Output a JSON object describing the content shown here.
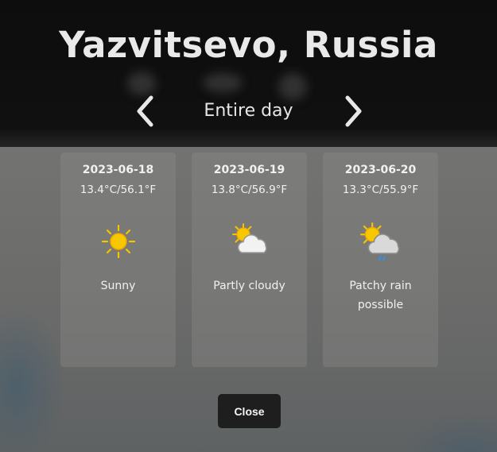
{
  "location": {
    "title": "Yazvitsevo, Russia"
  },
  "period_nav": {
    "label": "Entire day",
    "prev_icon": "chevron-left-icon",
    "next_icon": "chevron-right-icon"
  },
  "forecast": [
    {
      "date": "2023-06-18",
      "temp": "13.4°C/56.1°F",
      "condition": "Sunny",
      "icon": "sun-icon"
    },
    {
      "date": "2023-06-19",
      "temp": "13.8°C/56.9°F",
      "condition": "Partly cloudy",
      "icon": "partly-cloudy-icon"
    },
    {
      "date": "2023-06-20",
      "temp": "13.3°C/55.9°F",
      "condition": "Patchy rain possible",
      "icon": "patchy-rain-icon"
    }
  ],
  "actions": {
    "close_label": "Close"
  },
  "colors": {
    "sun": "#f5c400",
    "cloud": "#e8e8e8",
    "rain": "#3b8fd9",
    "button_bg": "#1e1e1e"
  }
}
